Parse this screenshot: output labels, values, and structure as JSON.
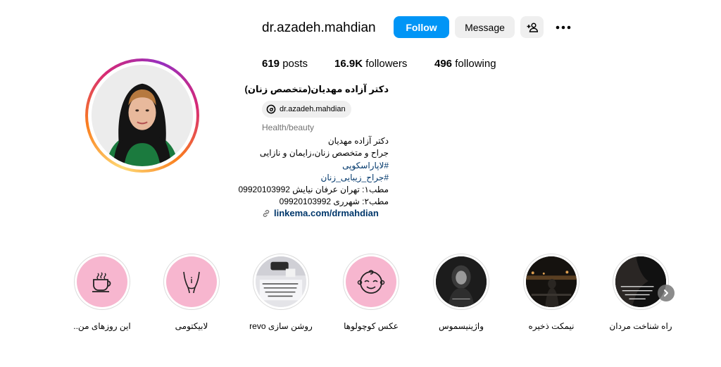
{
  "profile": {
    "username": "dr.azadeh.mahdian",
    "follow_label": "Follow",
    "message_label": "Message",
    "stats": {
      "posts_count": "619",
      "posts_label": "posts",
      "followers_count": "16.9K",
      "followers_label": "followers",
      "following_count": "496",
      "following_label": "following"
    },
    "full_name": "دکتر آزاده مهدیان(متخصص زنان)",
    "threads_handle": "dr.azadeh.mahdian",
    "category": "Health/beauty",
    "bio_lines": [
      "دکتر آزاده مهدیان",
      "جراح و متخصص زنان،زایمان و نازایی",
      "#لاپاراسکوپی",
      "#جراح_زیبایی_زنان",
      "مطب۱: تهران عرفان نیایش 09920103992",
      "مطب۲: شهرری 09920103992"
    ],
    "link_text": "linkema.com/drmahdian"
  },
  "highlights": [
    {
      "label": "این روزهای من..",
      "icon": "coffee-cup-icon"
    },
    {
      "label": "لابیکتومی",
      "icon": "body-icon"
    },
    {
      "label": "روشن سازی revo",
      "icon": "photo"
    },
    {
      "label": "عکس کوچولوها",
      "icon": "baby-face-icon"
    },
    {
      "label": "واژینیسموس",
      "icon": "photo-dark"
    },
    {
      "label": "نیمکت ذخیره",
      "icon": "photo-dark"
    },
    {
      "label": "راه شناخت مردان",
      "icon": "photo-dark"
    }
  ],
  "colors": {
    "follow_button": "#0095f6",
    "secondary_button": "#efefef",
    "link": "#00376b",
    "highlight_pink": "#f7b6cf"
  }
}
